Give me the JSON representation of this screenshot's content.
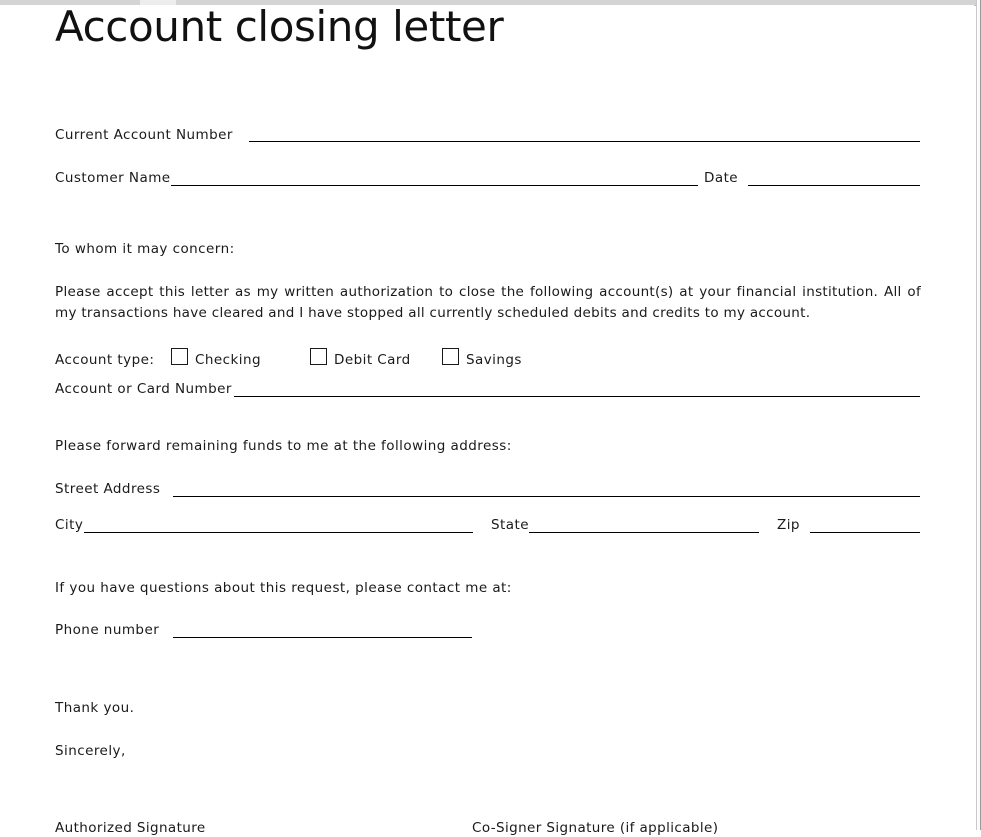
{
  "document": {
    "title": "Account closing letter"
  },
  "fields": {
    "current_account_number_label": "Current  Account  Number",
    "customer_name_label": "Customer  Name",
    "date_label": "Date",
    "account_or_card_number_label": "Account  or Card  Number",
    "street_address_label": "Street  Address",
    "city_label": "City",
    "state_label": "State",
    "zip_label": "Zip",
    "phone_number_label": "Phone  number"
  },
  "body": {
    "salutation": "To whom  it may  concern:",
    "paragraph": "Please  accept  this  letter  as my  written  authorization  to close  the following  account(s)  at your  financial  institution.  All  of my  transactions  have  cleared  and I have  stopped  all currently  scheduled  debits  and credits  to my  account.",
    "forward_funds": "Please  forward  remaining  funds  to me at the following  address:",
    "questions": "If you have  questions  about  this  request,  please  contact  me at:",
    "thank_you": "Thank  you.",
    "sincerely": "Sincerely,"
  },
  "account_type": {
    "label": "Account  type:",
    "options": [
      {
        "label": "Checking",
        "checked": false
      },
      {
        "label": "Debit  Card",
        "checked": false
      },
      {
        "label": "Savings",
        "checked": false
      }
    ]
  },
  "signatures": {
    "authorized": "Authorized  Signature",
    "cosigner": "Co-Signer Signature (if applicable)"
  },
  "colors": {
    "page_background": "#ffffff",
    "text": "#1a1a1a",
    "rule": "#000000",
    "chrome": "#d4d4d4"
  }
}
